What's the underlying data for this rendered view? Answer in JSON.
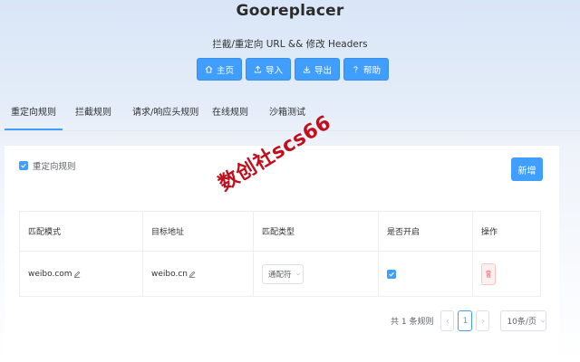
{
  "header": {
    "title": "Gooreplacer",
    "subtitle": "拦截/重定向 URL && 修改 Headers",
    "buttons": [
      {
        "label": "主页",
        "icon": "home-icon"
      },
      {
        "label": "导入",
        "icon": "upload-icon"
      },
      {
        "label": "导出",
        "icon": "download-icon"
      },
      {
        "label": "帮助",
        "icon": "question-icon"
      }
    ]
  },
  "tabs": [
    {
      "label": "重定向规则",
      "active": true
    },
    {
      "label": "拦截规则"
    },
    {
      "label": "请求/响应头规则"
    },
    {
      "label": "在线规则"
    },
    {
      "label": "沙箱测试"
    }
  ],
  "panel": {
    "enable_label": "重定向规则",
    "enable_checked": true,
    "add_button": "新增"
  },
  "table": {
    "columns": [
      "匹配模式",
      "目标地址",
      "匹配类型",
      "是否开启",
      "操作"
    ],
    "rows": [
      {
        "pattern": "weibo.com",
        "target": "weibo.cn",
        "match_type": "通配符",
        "enabled": true
      }
    ]
  },
  "pagination": {
    "total_text": "共 1 条规则",
    "current_page": "1",
    "page_size": "10条/页"
  },
  "watermark": "数创社scs66",
  "colors": {
    "primary": "#409eff",
    "danger": "#f56c6c",
    "watermark": "#c0101e"
  }
}
